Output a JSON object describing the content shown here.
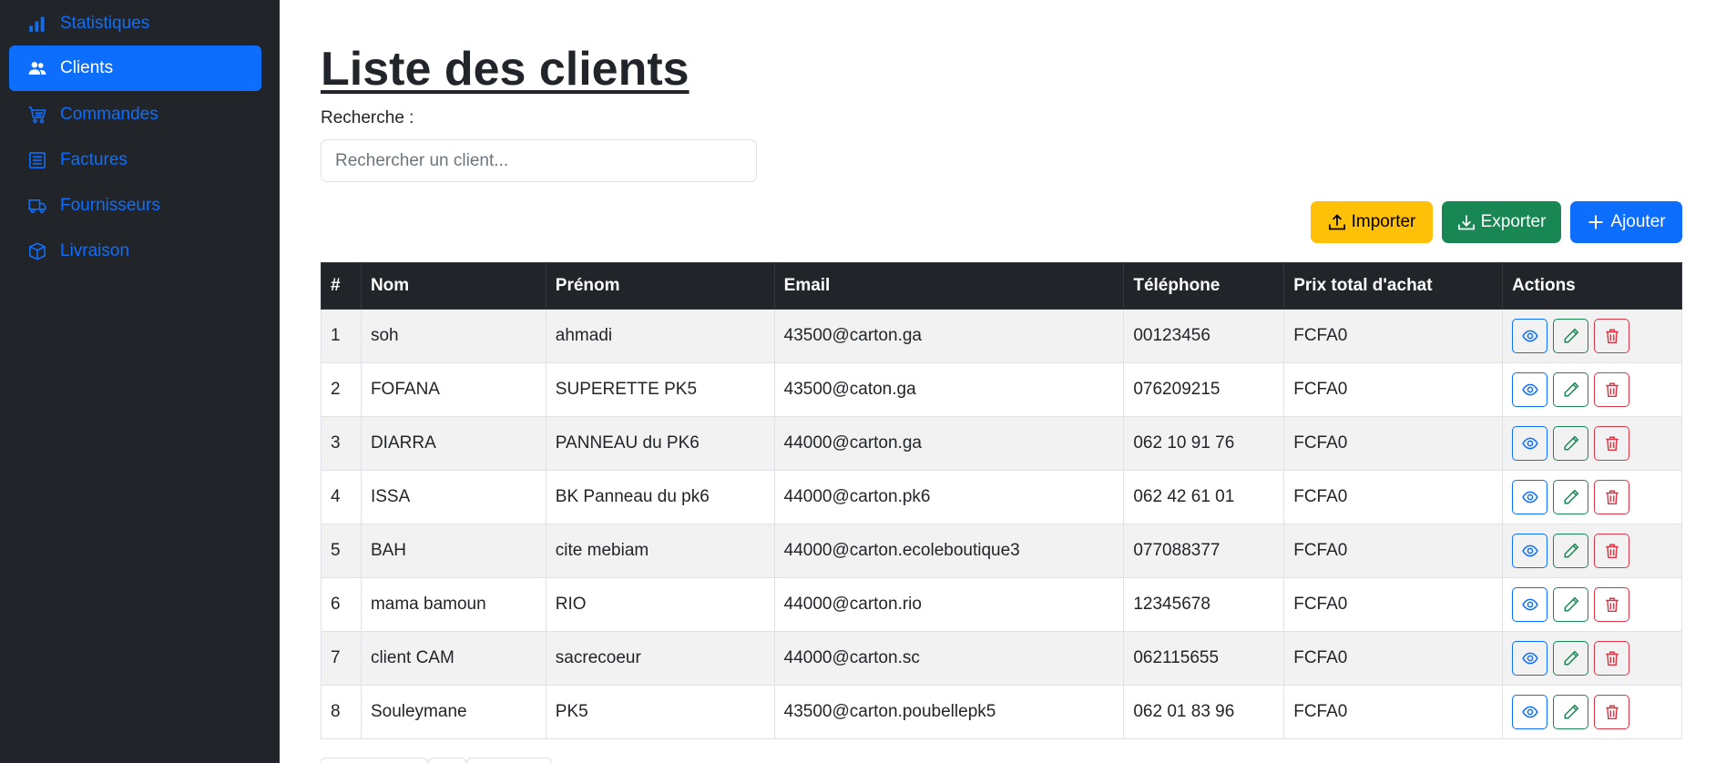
{
  "sidebar": {
    "items": [
      {
        "label": "Statistiques",
        "icon": "bar-chart-icon",
        "active": false
      },
      {
        "label": "Clients",
        "icon": "users-icon",
        "active": true
      },
      {
        "label": "Commandes",
        "icon": "cart-icon",
        "active": false
      },
      {
        "label": "Factures",
        "icon": "receipt-icon",
        "active": false
      },
      {
        "label": "Fournisseurs",
        "icon": "truck-icon",
        "active": false
      },
      {
        "label": "Livraison",
        "icon": "box-icon",
        "active": false
      }
    ]
  },
  "main": {
    "title": "Liste des clients",
    "search": {
      "label": "Recherche :",
      "placeholder": "Rechercher un client...",
      "value": ""
    },
    "toolbar": {
      "import_label": "Importer",
      "export_label": "Exporter",
      "add_label": "Ajouter"
    },
    "table": {
      "headers": [
        "#",
        "Nom",
        "Prénom",
        "Email",
        "Téléphone",
        "Prix total d'achat",
        "Actions"
      ],
      "rows": [
        {
          "num": "1",
          "nom": "soh",
          "prenom": "ahmadi",
          "email": "43500@carton.ga",
          "tel": "00123456",
          "prix": "FCFA0"
        },
        {
          "num": "2",
          "nom": "FOFANA",
          "prenom": "SUPERETTE PK5",
          "email": "43500@caton.ga",
          "tel": "076209215",
          "prix": "FCFA0"
        },
        {
          "num": "3",
          "nom": "DIARRA",
          "prenom": "PANNEAU du PK6",
          "email": "44000@carton.ga",
          "tel": "062 10 91 76",
          "prix": "FCFA0"
        },
        {
          "num": "4",
          "nom": "ISSA",
          "prenom": "BK Panneau du pk6",
          "email": "44000@carton.pk6",
          "tel": "062 42 61 01",
          "prix": "FCFA0"
        },
        {
          "num": "5",
          "nom": "BAH",
          "prenom": "cite mebiam",
          "email": "44000@carton.ecoleboutique3",
          "tel": "077088377",
          "prix": "FCFA0"
        },
        {
          "num": "6",
          "nom": "mama bamoun",
          "prenom": "RIO",
          "email": "44000@carton.rio",
          "tel": "12345678",
          "prix": "FCFA0"
        },
        {
          "num": "7",
          "nom": "client CAM",
          "prenom": "sacrecoeur",
          "email": "44000@carton.sc",
          "tel": "062115655",
          "prix": "FCFA0"
        },
        {
          "num": "8",
          "nom": "Souleymane",
          "prenom": "PK5",
          "email": "43500@carton.poubellepk5",
          "tel": "062 01 83 96",
          "prix": "FCFA0"
        }
      ]
    }
  },
  "colors": {
    "sidebar_bg": "#212529",
    "primary": "#0d6efd",
    "warning": "#ffc107",
    "success": "#198754",
    "danger": "#dc3545"
  }
}
